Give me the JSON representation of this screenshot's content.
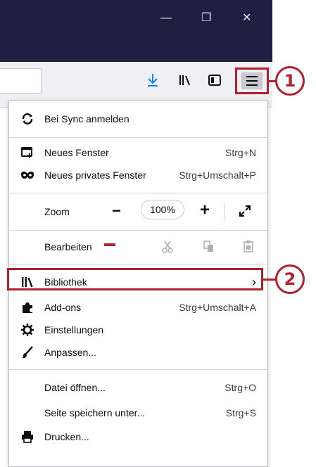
{
  "window": {
    "minimize_glyph": "—",
    "restore_glyph": "❐",
    "close_glyph": "✕"
  },
  "toolbar": {
    "icons": [
      "download-icon",
      "library-icon",
      "sidebar-icon",
      "hamburger-menu-icon"
    ]
  },
  "callouts": {
    "one": "1",
    "two": "2"
  },
  "menu": {
    "sync": {
      "label": "Bei Sync anmelden"
    },
    "new_window": {
      "label": "Neues Fenster",
      "shortcut": "Strg+N"
    },
    "private_window": {
      "label": "Neues privates Fenster",
      "shortcut": "Strg+Umschalt+P"
    },
    "zoom": {
      "label": "Zoom",
      "minus": "−",
      "value": "100%",
      "plus": "+"
    },
    "edit": {
      "label": "Bearbeiten"
    },
    "library": {
      "label": "Bibliothek",
      "arrow": "›"
    },
    "addons": {
      "label": "Add-ons",
      "shortcut": "Strg+Umschalt+A"
    },
    "settings": {
      "label": "Einstellungen"
    },
    "customize": {
      "label": "Anpassen..."
    },
    "open_file": {
      "label": "Datei öffnen...",
      "shortcut": "Strg+O"
    },
    "save_page": {
      "label": "Seite speichern unter...",
      "shortcut": "Strg+S"
    },
    "print": {
      "label": "Drucken..."
    }
  },
  "colors": {
    "titlebar": "#1d2041",
    "callout": "#b21f2d",
    "toolbar": "#f0f0f4",
    "download": "#0a84ff"
  }
}
